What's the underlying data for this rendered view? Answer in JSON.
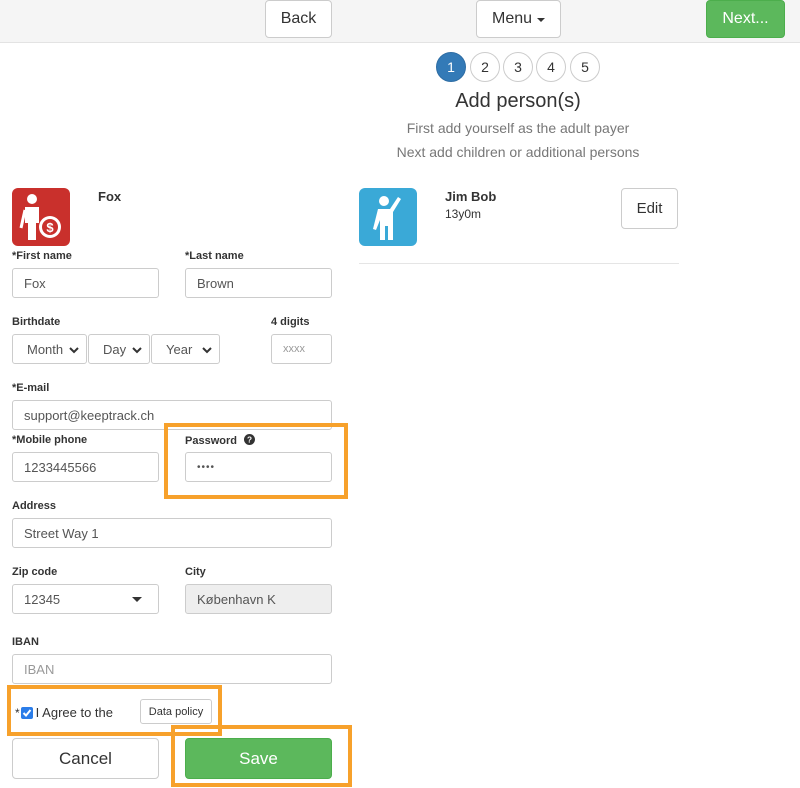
{
  "nav": {
    "back": "Back",
    "menu": "Menu",
    "next": "Next..."
  },
  "steps": [
    "1",
    "2",
    "3",
    "4",
    "5"
  ],
  "active_step": 1,
  "header": {
    "title": "Add person(s)",
    "line1": "First add yourself as the adult payer",
    "line2": "Next add children or additional persons"
  },
  "payer": {
    "name": "Fox"
  },
  "form": {
    "first_name_label": "*First name",
    "first_name_value": "Fox",
    "last_name_label": "*Last name",
    "last_name_value": "Brown",
    "birthdate_label": "Birthdate",
    "month_value": "Month",
    "day_value": "Day",
    "year_value": "Year",
    "digits_label": "4 digits",
    "digits_placeholder": "xxxx",
    "email_label": "*E-mail",
    "email_value": "support@keeptrack.ch",
    "mobile_label": "*Mobile phone",
    "mobile_value": "1233445566",
    "password_label": "Password",
    "password_value": "••••",
    "address_label": "Address",
    "address_value": "Street Way 1",
    "zip_label": "Zip code",
    "zip_value": "12345",
    "city_label": "City",
    "city_value": "København K",
    "iban_label": "IBAN",
    "iban_placeholder": "IBAN",
    "agree_star": "*",
    "agree_label": "I Agree to the",
    "agree_checked": true,
    "policy_button": "Data policy",
    "cancel": "Cancel",
    "save": "Save"
  },
  "persons": [
    {
      "name": "Jim Bob",
      "age": "13y0m",
      "edit": "Edit"
    }
  ],
  "colors": {
    "highlight": "#f7a12b",
    "green": "#5cb85c",
    "active_step": "#337ab7",
    "payer_icon_bg": "#c9302c",
    "child_icon_bg": "#3aa9d7"
  },
  "icons": {
    "payer": "person-with-money-icon",
    "child": "waving-child-icon",
    "help": "question-circle-icon"
  }
}
